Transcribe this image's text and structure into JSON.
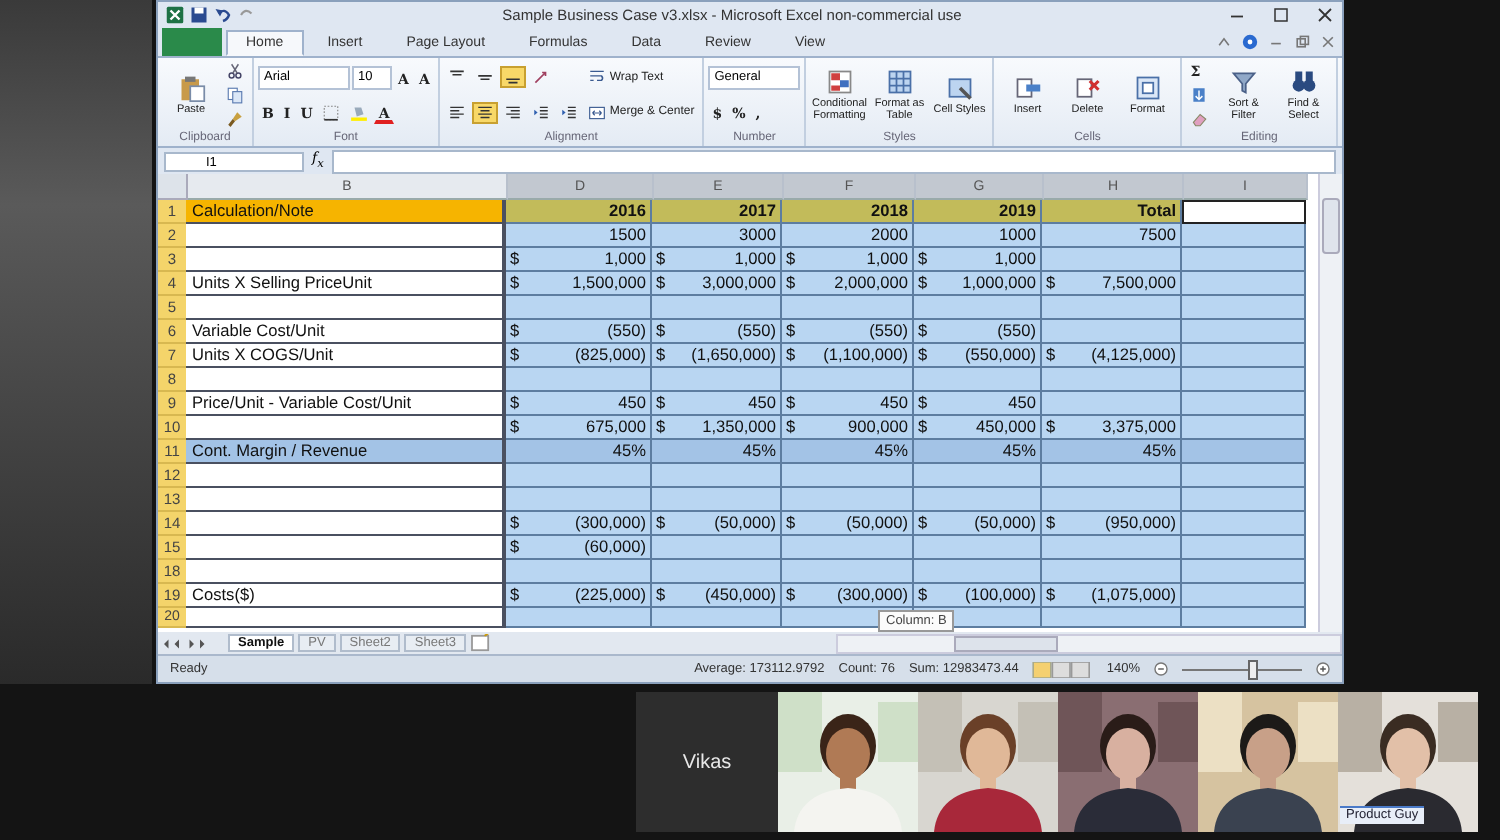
{
  "window": {
    "title": "Sample Business Case v3.xlsx  -  Microsoft Excel non-commercial use"
  },
  "tabs": [
    {
      "kind": "file",
      "selected": false
    },
    {
      "kind": "tab",
      "label": "Home",
      "selected": true
    },
    {
      "kind": "tab",
      "label": "Insert",
      "selected": false
    },
    {
      "kind": "tab",
      "label": "Page Layout",
      "selected": false
    },
    {
      "kind": "tab",
      "label": "Formulas",
      "selected": false
    },
    {
      "kind": "tab",
      "label": "Data",
      "selected": false
    },
    {
      "kind": "tab",
      "label": "Review",
      "selected": false
    },
    {
      "kind": "tab",
      "label": "View",
      "selected": false
    }
  ],
  "ribbon_groups": [
    {
      "label": "Clipboard",
      "cols": [
        [
          [
            {
              "kind": "paste",
              "label": "Paste"
            }
          ]
        ],
        [
          [
            {
              "kind": "scissors"
            }
          ],
          [
            {
              "kind": "copy"
            }
          ],
          [
            {
              "kind": "brush"
            }
          ]
        ]
      ]
    },
    {
      "label": "Font",
      "cols": [
        [
          [
            {
              "kind": "field",
              "value": "Arial"
            },
            {
              "kind": "field",
              "value": "10"
            },
            {
              "kind": "text",
              "label": "A"
            },
            {
              "kind": "text",
              "label": "A"
            }
          ],
          [
            {
              "kind": "text",
              "label": "B"
            },
            {
              "kind": "text",
              "label": "I"
            },
            {
              "kind": "text",
              "label": "U"
            },
            {
              "kind": "border"
            },
            {
              "kind": "bucket"
            },
            {
              "kind": "fontcolor",
              "label": "A",
              "color": "#e02020"
            }
          ]
        ]
      ]
    },
    {
      "label": "Alignment",
      "cols": [
        [
          [
            {
              "kind": "aligntop",
              "selected": false
            },
            {
              "kind": "alignmiddle",
              "selected": false
            },
            {
              "kind": "alignbottom",
              "selected": true
            },
            {
              "kind": "orient"
            }
          ],
          [
            {
              "kind": "alignleft",
              "selected": false
            },
            {
              "kind": "aligncenter",
              "selected": true
            },
            {
              "kind": "alignright",
              "selected": false
            },
            {
              "kind": "indent"
            },
            {
              "kind": "indent"
            }
          ]
        ],
        [
          [
            {
              "kind": "wrap",
              "label": "Wrap Text"
            }
          ],
          [
            {
              "kind": "merge",
              "label": "Merge & Center"
            }
          ]
        ]
      ]
    },
    {
      "label": "Number",
      "cols": [
        [
          [
            {
              "kind": "field",
              "value": "General"
            }
          ],
          [
            {
              "kind": "text",
              "label": "$"
            },
            {
              "kind": "text",
              "label": "%"
            },
            {
              "kind": "text",
              "label": ","
            }
          ]
        ]
      ]
    },
    {
      "label": "Styles",
      "cols": [
        [
          [
            {
              "kind": "condformat",
              "label": "Conditional Formatting"
            }
          ]
        ],
        [
          [
            {
              "kind": "tableformat",
              "label": "Format as Table"
            }
          ]
        ],
        [
          [
            {
              "kind": "cellstyles",
              "label": "Cell Styles"
            }
          ]
        ]
      ]
    },
    {
      "label": "Cells",
      "cols": [
        [
          [
            {
              "kind": "insert",
              "label": "Insert"
            }
          ]
        ],
        [
          [
            {
              "kind": "delete",
              "label": "Delete"
            }
          ]
        ],
        [
          [
            {
              "kind": "format",
              "label": "Format"
            }
          ]
        ]
      ]
    },
    {
      "label": "Editing",
      "cols": [
        [
          [
            {
              "kind": "text",
              "label": "Σ"
            }
          ],
          [
            {
              "kind": "filldown"
            }
          ],
          [
            {
              "kind": "eraser"
            }
          ]
        ],
        [
          [
            {
              "kind": "sort",
              "label": "Sort & Filter"
            }
          ]
        ],
        [
          [
            {
              "kind": "find",
              "label": "Find & Select"
            }
          ]
        ]
      ]
    }
  ],
  "formula_bar": {
    "name_box": "I1",
    "fx": "f$_{x}$"
  },
  "columns": [
    {
      "letter": "B",
      "selected": false
    },
    {
      "letter": "D",
      "selected": true
    },
    {
      "letter": "E",
      "selected": true
    },
    {
      "letter": "F",
      "selected": true
    },
    {
      "letter": "G",
      "selected": true
    },
    {
      "letter": "H",
      "selected": true
    },
    {
      "letter": "I",
      "selected": true
    }
  ],
  "rows": [
    {
      "num": "1",
      "kind": "header",
      "label": "Calculation/Note",
      "cells": [
        {
          "value": "2016"
        },
        {
          "value": "2017"
        },
        {
          "value": "2018"
        },
        {
          "value": "2019"
        },
        {
          "value": "Total"
        },
        {
          "active": true
        }
      ]
    },
    {
      "num": "2",
      "kind": "normal",
      "cells": [
        {
          "value": "1500"
        },
        {
          "value": "3000"
        },
        {
          "value": "2000"
        },
        {
          "value": "1000"
        },
        {
          "value": "7500"
        }
      ]
    },
    {
      "num": "3",
      "kind": "normal",
      "cells": [
        {
          "sign": "$",
          "value": "1,000"
        },
        {
          "sign": "$",
          "value": "1,000"
        },
        {
          "sign": "$",
          "value": "1,000"
        },
        {
          "sign": "$",
          "value": "1,000"
        }
      ]
    },
    {
      "num": "4",
      "kind": "normal",
      "label": "Units X Selling PriceUnit",
      "cells": [
        {
          "sign": "$",
          "value": "1,500,000"
        },
        {
          "sign": "$",
          "value": "3,000,000"
        },
        {
          "sign": "$",
          "value": "2,000,000"
        },
        {
          "sign": "$",
          "value": "1,000,000"
        },
        {
          "sign": "$",
          "value": "7,500,000"
        }
      ]
    },
    {
      "num": "5",
      "kind": "normal"
    },
    {
      "num": "6",
      "kind": "normal",
      "label": "Variable Cost/Unit",
      "cells": [
        {
          "sign": "$",
          "value": "(550)"
        },
        {
          "sign": "$",
          "value": "(550)"
        },
        {
          "sign": "$",
          "value": "(550)"
        },
        {
          "sign": "$",
          "value": "(550)"
        }
      ]
    },
    {
      "num": "7",
      "kind": "normal",
      "label": "Units X COGS/Unit",
      "cells": [
        {
          "sign": "$",
          "value": "(825,000)"
        },
        {
          "sign": "$",
          "value": "(1,650,000)"
        },
        {
          "sign": "$",
          "value": "(1,100,000)"
        },
        {
          "sign": "$",
          "value": "(550,000)"
        },
        {
          "sign": "$",
          "value": "(4,125,000)"
        }
      ]
    },
    {
      "num": "8",
      "kind": "normal"
    },
    {
      "num": "9",
      "kind": "normal",
      "label": "Price/Unit - Variable Cost/Unit",
      "cells": [
        {
          "sign": "$",
          "value": "450"
        },
        {
          "sign": "$",
          "value": "450"
        },
        {
          "sign": "$",
          "value": "450"
        },
        {
          "sign": "$",
          "value": "450"
        }
      ]
    },
    {
      "num": "10",
      "kind": "normal",
      "cells": [
        {
          "sign": "$",
          "value": "675,000"
        },
        {
          "sign": "$",
          "value": "1,350,000"
        },
        {
          "sign": "$",
          "value": "900,000"
        },
        {
          "sign": "$",
          "value": "450,000"
        },
        {
          "sign": "$",
          "value": "3,375,000"
        }
      ]
    },
    {
      "num": "11",
      "kind": "grey",
      "label": "Cont. Margin / Revenue",
      "cells": [
        {
          "value": "45%"
        },
        {
          "value": "45%"
        },
        {
          "value": "45%"
        },
        {
          "value": "45%"
        },
        {
          "value": "45%"
        }
      ]
    },
    {
      "num": "12",
      "kind": "normal"
    },
    {
      "num": "13",
      "kind": "normal"
    },
    {
      "num": "14",
      "kind": "normal",
      "cells": [
        {
          "sign": "$",
          "value": "(300,000)"
        },
        {
          "sign": "$",
          "value": "(50,000)"
        },
        {
          "sign": "$",
          "value": "(50,000)"
        },
        {
          "sign": "$",
          "value": "(50,000)"
        },
        {
          "sign": "$",
          "value": "(950,000)"
        }
      ]
    },
    {
      "num": "15",
      "kind": "normal",
      "cells": [
        {
          "sign": "$",
          "value": "(60,000)"
        }
      ]
    },
    {
      "num": "18",
      "kind": "normal"
    },
    {
      "num": "19",
      "kind": "normal",
      "label": "Costs($)",
      "cells": [
        {
          "sign": "$",
          "value": "(225,000)"
        },
        {
          "sign": "$",
          "value": "(450,000)"
        },
        {
          "sign": "$",
          "value": "(300,000)"
        },
        {
          "sign": "$",
          "value": "(100,000)"
        },
        {
          "sign": "$",
          "value": "(1,075,000)"
        }
      ]
    },
    {
      "num": "20",
      "kind": "cut"
    }
  ],
  "tooltip": "Column: B",
  "sheet_tabs": [
    {
      "label": "Sample",
      "selected": true
    },
    {
      "label": "PV",
      "selected": false
    },
    {
      "label": "Sheet2",
      "selected": false
    },
    {
      "label": "Sheet3",
      "selected": false
    }
  ],
  "status_bar": {
    "mode": "Ready",
    "average": "Average: 173112.9792",
    "count": "Count: 76",
    "sum": "Sum: 12983473.44",
    "zoom": "140%",
    "zoom_level": {
      "level": 0.58
    }
  },
  "video_tiles": [
    {
      "kind": "name",
      "name": "Vikas"
    },
    {
      "kind": "picture"
    },
    {
      "kind": "picture"
    },
    {
      "kind": "picture"
    },
    {
      "kind": "picture"
    },
    {
      "kind": "picture",
      "caption": "Product Guy"
    }
  ]
}
